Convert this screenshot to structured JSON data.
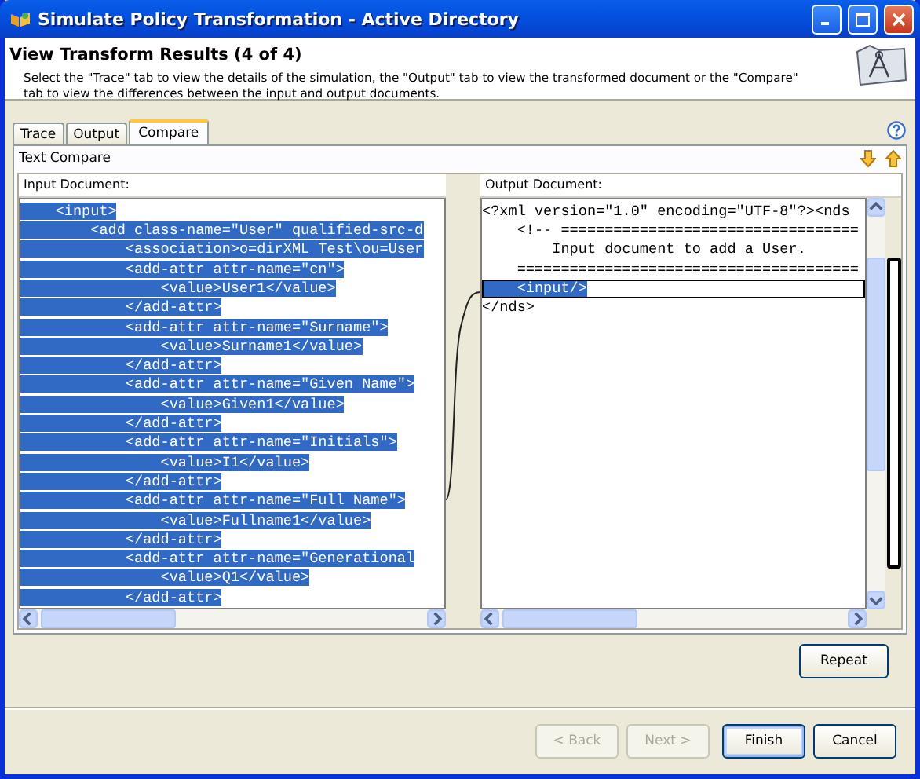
{
  "window": {
    "title": "Simulate Policy Transformation - Active Directory"
  },
  "header": {
    "title": "View Transform Results (4 of 4)",
    "description": "Select the \"Trace\" tab to view the details of the simulation, the \"Output\" tab to view the transformed document or the \"Compare\" tab to view the differences between the input and output documents."
  },
  "tabs": [
    {
      "label": "Trace",
      "selected": false
    },
    {
      "label": "Output",
      "selected": false
    },
    {
      "label": "Compare",
      "selected": true
    }
  ],
  "compare": {
    "title": "Text Compare",
    "input": {
      "label": "Input Document:",
      "lines": [
        {
          "text": "    <input>",
          "selected": true
        },
        {
          "text": "        <add class-name=\"User\" qualified-src-d",
          "selected": true
        },
        {
          "text": "            <association>o=dirXML Test\\ou=User",
          "selected": true
        },
        {
          "text": "            <add-attr attr-name=\"cn\">",
          "selected": true
        },
        {
          "text": "                <value>User1</value>",
          "selected": true
        },
        {
          "text": "            </add-attr>",
          "selected": true
        },
        {
          "text": "            <add-attr attr-name=\"Surname\">",
          "selected": true
        },
        {
          "text": "                <value>Surname1</value>",
          "selected": true
        },
        {
          "text": "            </add-attr>",
          "selected": true
        },
        {
          "text": "            <add-attr attr-name=\"Given Name\">",
          "selected": true
        },
        {
          "text": "                <value>Given1</value>",
          "selected": true
        },
        {
          "text": "            </add-attr>",
          "selected": true
        },
        {
          "text": "            <add-attr attr-name=\"Initials\">",
          "selected": true
        },
        {
          "text": "                <value>I1</value>",
          "selected": true
        },
        {
          "text": "            </add-attr>",
          "selected": true
        },
        {
          "text": "            <add-attr attr-name=\"Full Name\">",
          "selected": true
        },
        {
          "text": "                <value>Fullname1</value>",
          "selected": true
        },
        {
          "text": "            </add-attr>",
          "selected": true
        },
        {
          "text": "            <add-attr attr-name=\"Generational",
          "selected": true
        },
        {
          "text": "                <value>Q1</value>",
          "selected": true
        },
        {
          "text": "            </add-attr>",
          "selected": true
        }
      ]
    },
    "output": {
      "label": "Output Document:",
      "lines": [
        {
          "text": "<?xml version=\"1.0\" encoding=\"UTF-8\"?><nds",
          "selected": false
        },
        {
          "text": "    <!-- ==================================",
          "selected": false
        },
        {
          "text": "        Input document to add a User.",
          "selected": false
        },
        {
          "text": "    =======================================",
          "selected": false
        },
        {
          "text": "    <input/>",
          "selected": true
        },
        {
          "text": "</nds>",
          "selected": false
        }
      ]
    }
  },
  "repeat_button": {
    "label": "Repeat"
  },
  "footer_buttons": [
    {
      "label": "< Back",
      "disabled": true,
      "default": false
    },
    {
      "label": "Next >",
      "disabled": true,
      "default": false
    },
    {
      "label": "Finish",
      "disabled": false,
      "default": true
    },
    {
      "label": "Cancel",
      "disabled": false,
      "default": false
    }
  ]
}
